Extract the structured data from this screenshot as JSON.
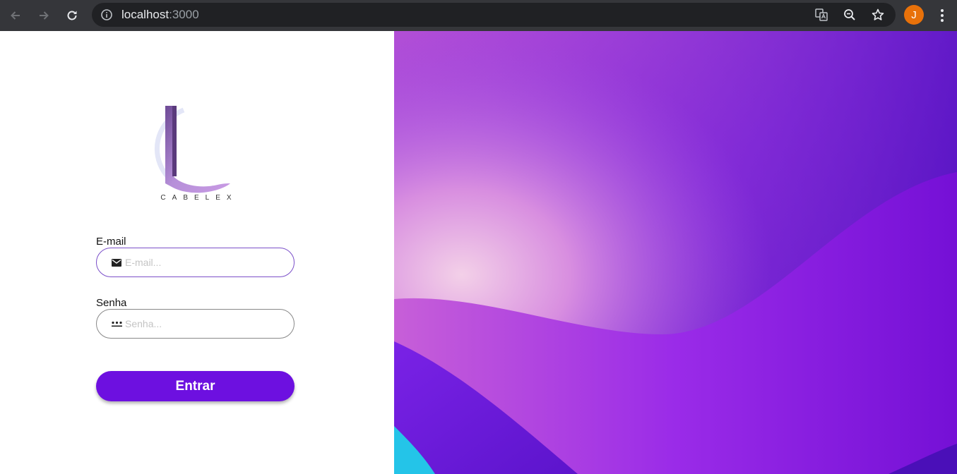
{
  "browser": {
    "url_host": "localhost",
    "url_port": ":3000",
    "profile_initial": "J",
    "icons": [
      "back-arrow-icon",
      "forward-arrow-icon",
      "reload-icon",
      "info-icon",
      "translate-icon",
      "zoom-out-icon",
      "star-icon",
      "kebab-menu-icon"
    ]
  },
  "login": {
    "brand_name": "CABELEX",
    "email_label": "E-mail",
    "email_placeholder": "E-mail...",
    "email_value": "",
    "password_label": "Senha",
    "password_placeholder": "Senha...",
    "password_value": "",
    "submit_label": "Entrar",
    "accent_color": "#6d10e0"
  },
  "colors": {
    "chrome_bg": "#35363a",
    "omnibox_bg": "#202124",
    "avatar_bg": "#e8710a"
  }
}
